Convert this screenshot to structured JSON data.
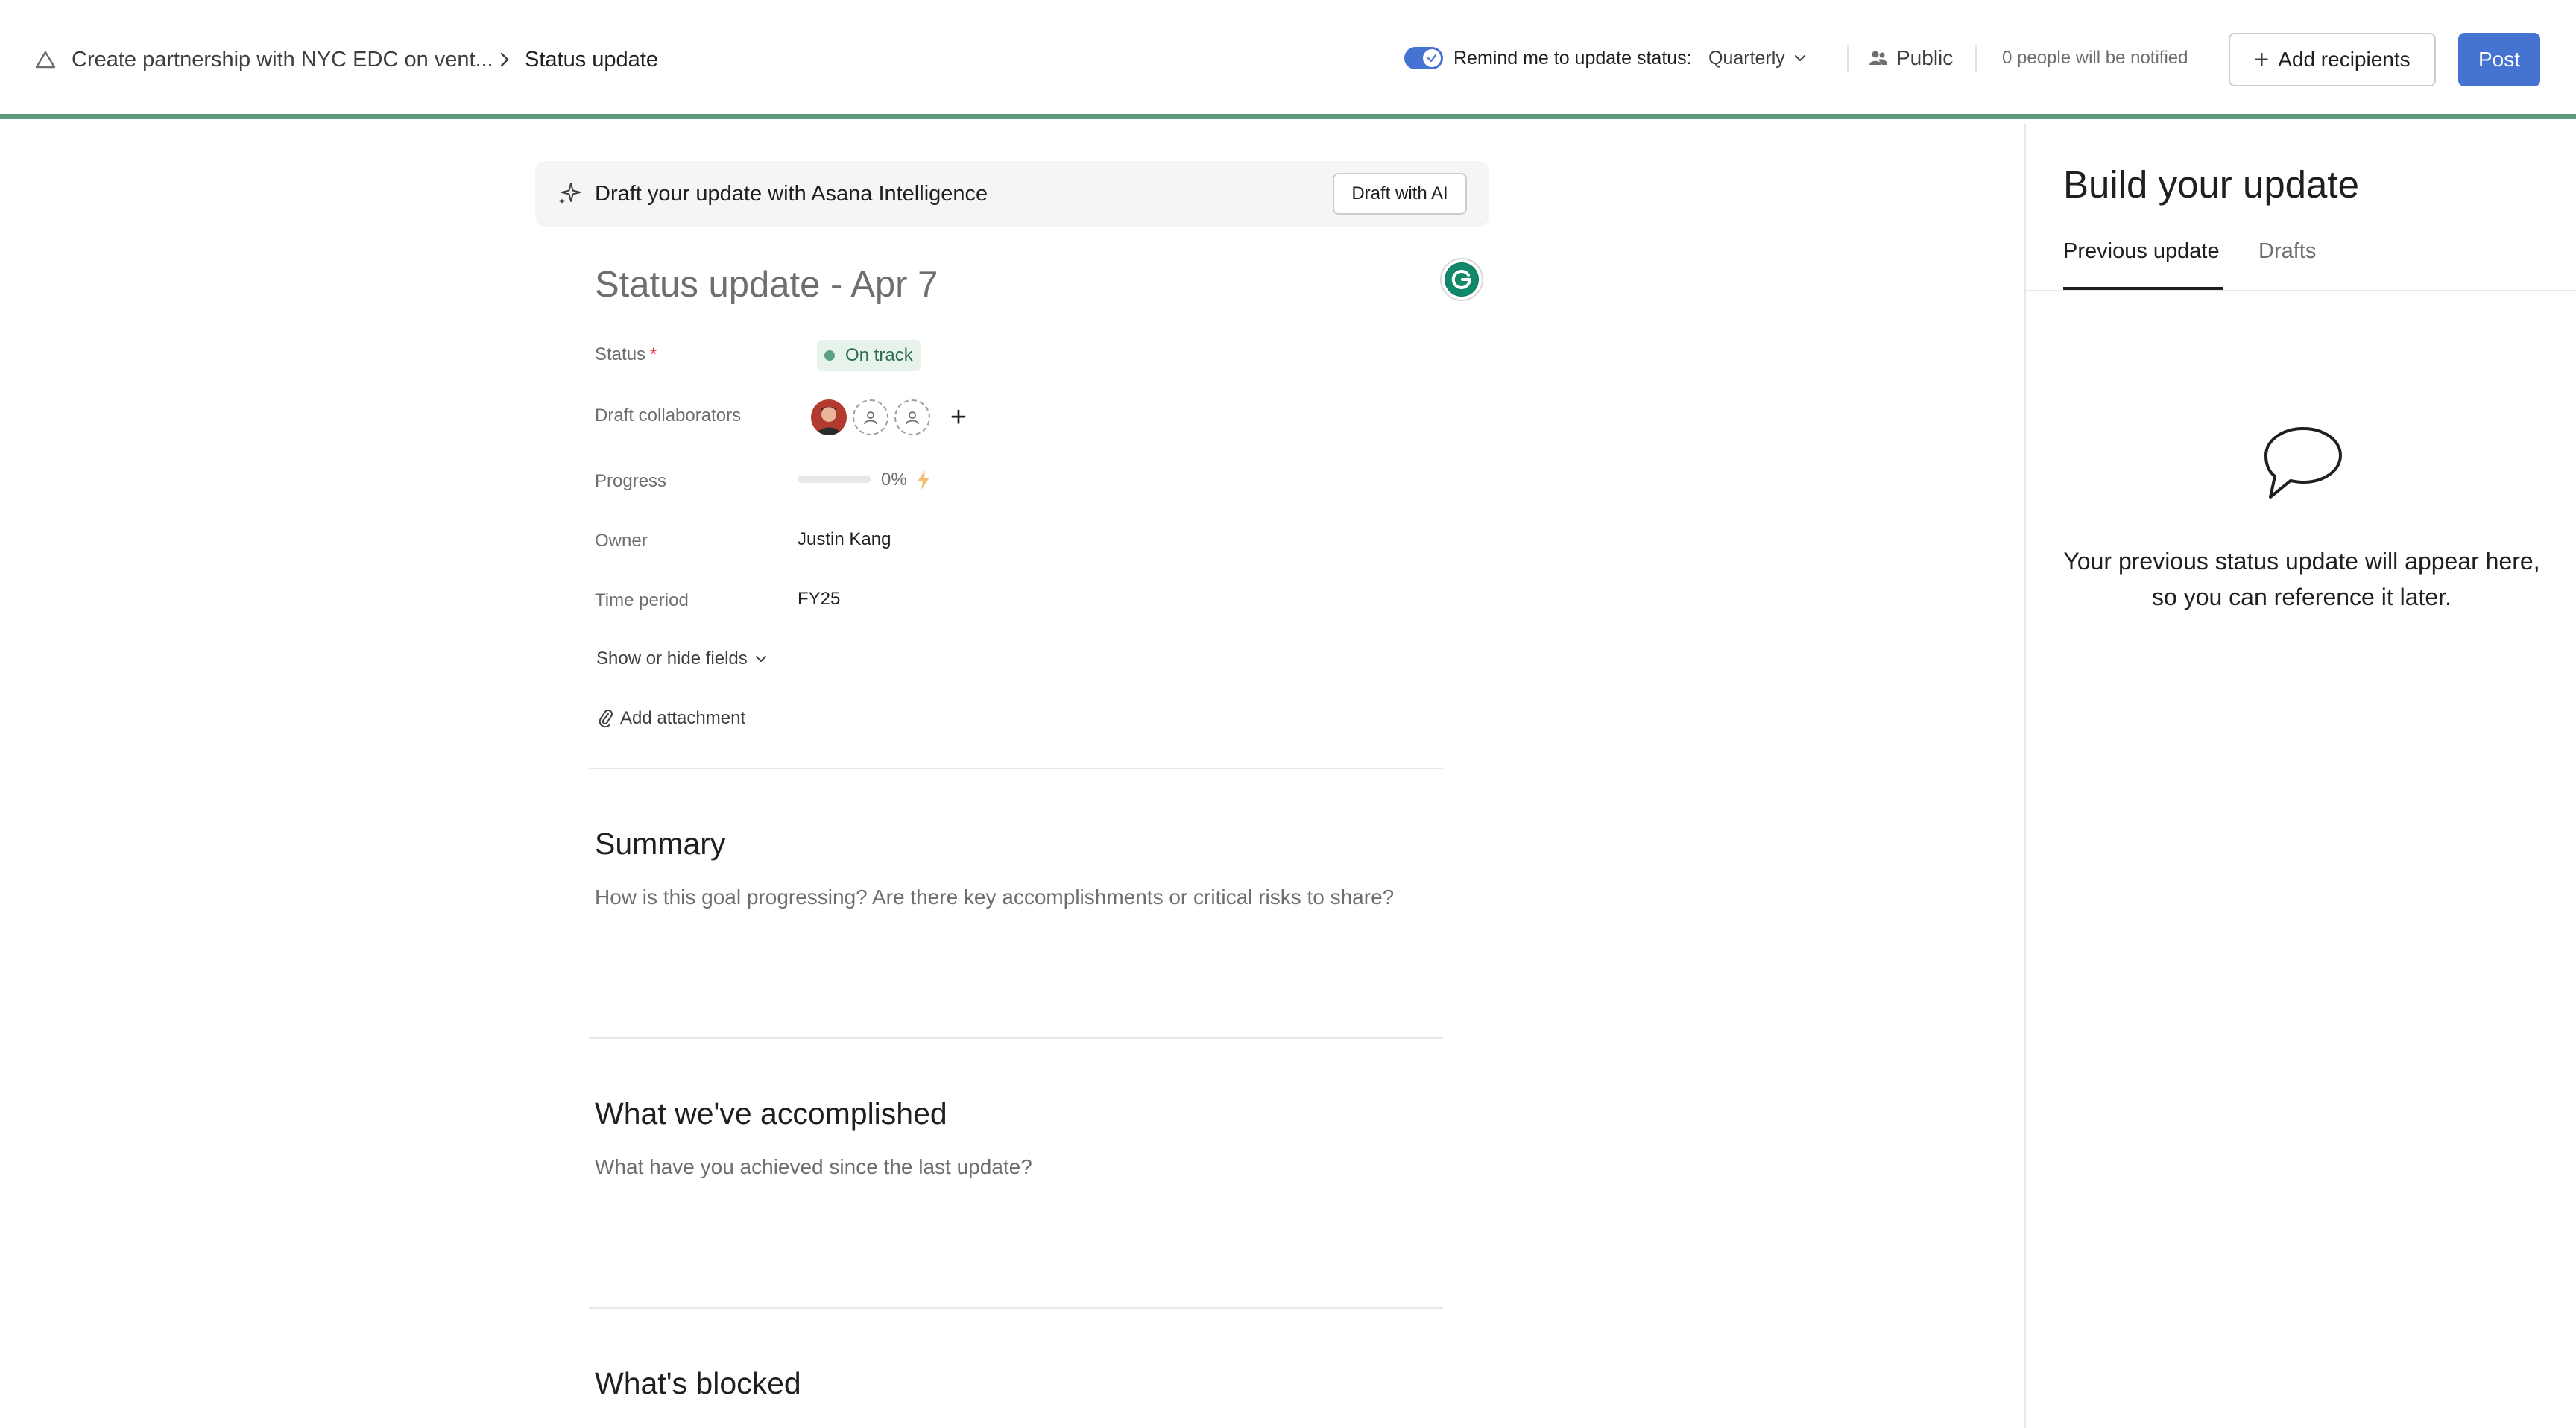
{
  "header": {
    "breadcrumb_goal": "Create partnership with NYC EDC on vent...",
    "breadcrumb_current": "Status update",
    "remind_label": "Remind me to update status:",
    "remind_frequency": "Quarterly",
    "visibility": "Public",
    "notified_text": "0 people will be notified",
    "add_recipients_label": "Add recipients",
    "post_label": "Post",
    "accent_color": "#4573d2",
    "progress_border_color": "#5f9a7d"
  },
  "ai": {
    "prompt_text": "Draft your update with Asana Intelligence",
    "button_label": "Draft with AI"
  },
  "form": {
    "title_placeholder": "Status update - Apr 7",
    "status_label": "Status",
    "status_required_mark": "*",
    "status_value": "On track",
    "collaborators_label": "Draft collaborators",
    "progress_label": "Progress",
    "progress_value": "0%",
    "progress_fraction": 0,
    "owner_label": "Owner",
    "owner_value": "Justin Kang",
    "time_period_label": "Time period",
    "time_period_value": "FY25",
    "show_hide_label": "Show or hide fields",
    "add_attachment_label": "Add attachment"
  },
  "sections": {
    "summary_title": "Summary",
    "summary_placeholder": "How is this goal progressing? Are there key accomplishments or critical risks to share?",
    "accomplished_title": "What we've accomplished",
    "accomplished_placeholder": "What have you achieved since the last update?",
    "blocked_title": "What's blocked"
  },
  "right_panel": {
    "title": "Build your update",
    "tab_previous": "Previous update",
    "tab_drafts": "Drafts",
    "empty_message": "Your previous status update will appear here, so you can reference it later."
  }
}
